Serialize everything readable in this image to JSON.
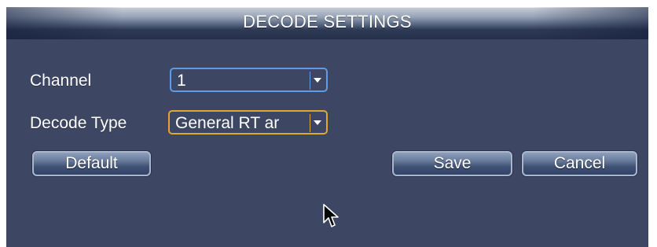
{
  "dialog": {
    "title": "DECODE SETTINGS"
  },
  "form": {
    "channel_label": "Channel",
    "channel_value": "1",
    "decode_type_label": "Decode Type",
    "decode_type_value": "General RT ar"
  },
  "buttons": {
    "default_label": "Default",
    "save_label": "Save",
    "cancel_label": "Cancel"
  },
  "icons": {
    "dropdown": "chevron-down-icon",
    "cursor": "mouse-pointer-icon"
  },
  "colors": {
    "panel_bg": "#3d4663",
    "focus_orange": "#e3a630",
    "combo_blue": "#5f9be8"
  }
}
